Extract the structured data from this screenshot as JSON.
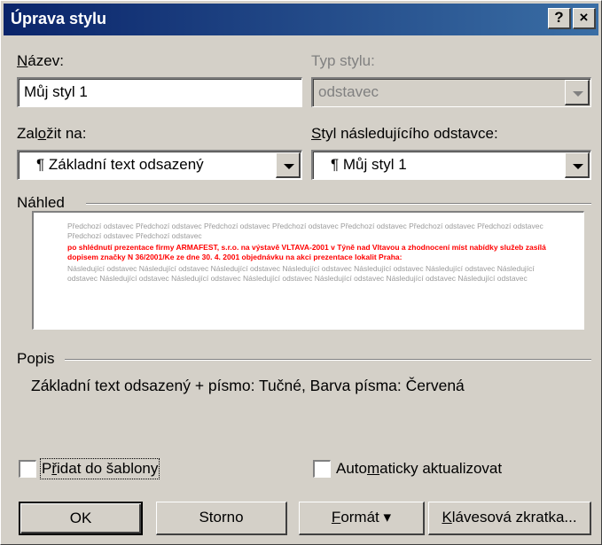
{
  "window": {
    "title": "Úprava stylu",
    "help_label": "?",
    "close_label": "×"
  },
  "name": {
    "label_first": "N",
    "label_rest": "ázev:",
    "value": "Můj styl 1"
  },
  "style_type": {
    "label": "Typ stylu:",
    "value": "odstavec"
  },
  "based_on": {
    "label_pre": "Zal",
    "label_u": "o",
    "label_post": "žit na:",
    "value": "¶ Základní text odsazený"
  },
  "next_style": {
    "label_u": "S",
    "label_post": "tyl následujícího odstavce:",
    "value": "¶ Můj styl 1"
  },
  "preview": {
    "label": "Náhled",
    "prev_text": "Předchozí odstavec Předchozí odstavec Předchozí odstavec Předchozí odstavec Předchozí odstavec Předchozí odstavec Předchozí odstavec Předchozí odstavec Předchozí odstavec",
    "styled_text": "po shlédnutí prezentace firmy ARMAFEST, s.r.o. na výstavě VLTAVA-2001 v Týně nad Vltavou a zhodnocení míst nabídky služeb zasílá dopisem značky N 36/2001/Ke ze dne 30. 4. 2001 objednávku na akci prezentace lokalit Praha:",
    "next_text": "Následující odstavec Následující odstavec Následující odstavec Následující odstavec Následující odstavec Následující odstavec Následující odstavec Následující odstavec Následující odstavec Následující odstavec Následující odstavec Následující odstavec Následující odstavec"
  },
  "description": {
    "label": "Popis",
    "text": "Základní text odsazený + písmo: Tučné, Barva písma: Červená"
  },
  "add_to_template": {
    "label_pre": "P",
    "label_u": "ř",
    "label_post": "idat do šablony",
    "checked": false
  },
  "auto_update": {
    "label_pre": "Auto",
    "label_u": "m",
    "label_post": "aticky aktualizovat",
    "checked": false
  },
  "buttons": {
    "ok": "OK",
    "cancel": "Storno",
    "format_u": "F",
    "format_rest": "ormát",
    "format_arrow": "▾",
    "shortcut_u": "K",
    "shortcut_rest": "lávesová zkratka..."
  }
}
